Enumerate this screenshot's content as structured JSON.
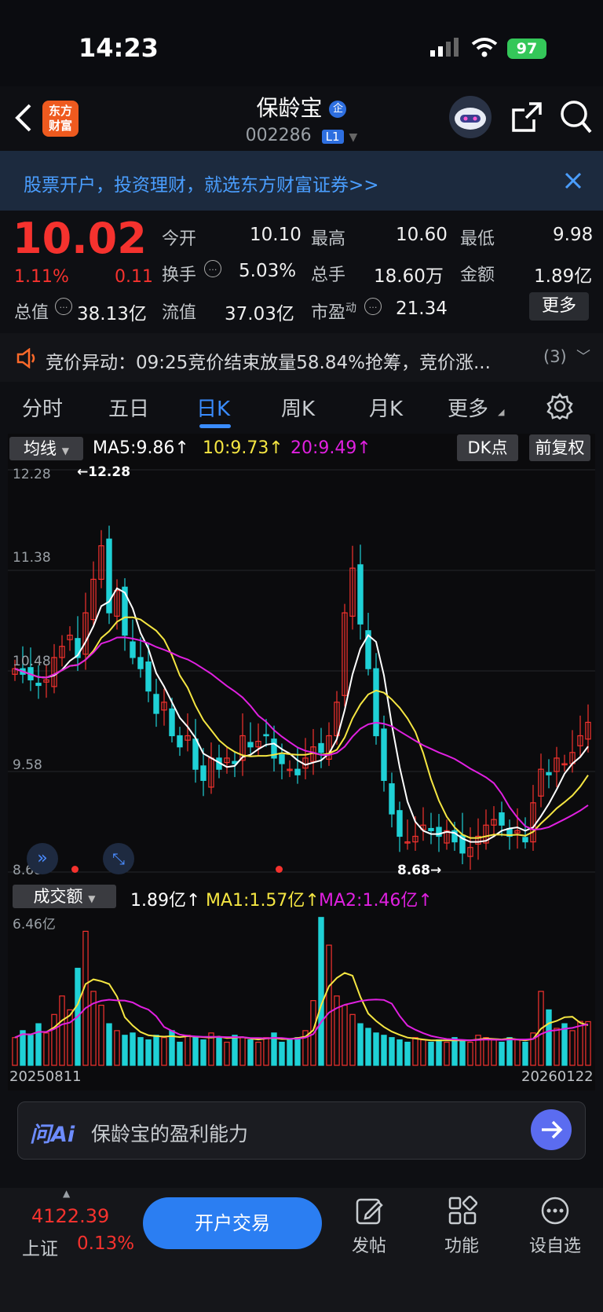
{
  "status_bar": {
    "time": "14:23",
    "battery": "97"
  },
  "header": {
    "stock_name": "保龄宝",
    "badge": "企",
    "stock_code": "002286",
    "level": "L1",
    "logo_line1": "东方",
    "logo_line2": "财富"
  },
  "banner": {
    "text": "股票开户，投资理财，就选东方财富证券>>"
  },
  "quote": {
    "price": "10.02",
    "change_pct": "1.11%",
    "change": "0.11",
    "open_label": "今开",
    "open": "10.10",
    "high_label": "最高",
    "high": "10.60",
    "low_label": "最低",
    "low": "9.98",
    "turnover_label": "换手",
    "turnover": "5.03%",
    "volume_label": "总手",
    "volume": "18.60万",
    "amount_label": "金额",
    "amount": "1.89亿",
    "mktcap_label": "总值",
    "mktcap": "38.13亿",
    "float_label": "流值",
    "float": "37.03亿",
    "pe_label": "市盈",
    "pe_sup": "动",
    "pe": "21.34",
    "more": "更多"
  },
  "auction": {
    "text": "竞价异动：09:25竞价结束放量58.84%抢筹，竞价涨...",
    "count": "(3)"
  },
  "tabs": [
    "分时",
    "五日",
    "日K",
    "周K",
    "月K",
    "更多"
  ],
  "active_tab": 2,
  "kline": {
    "selector": "均线",
    "ma5": "MA5:9.86",
    "ma10": "10:9.73",
    "ma20": "20:9.49",
    "dk": "DK点",
    "adjust": "前复权",
    "y_ticks": [
      "12.28",
      "11.38",
      "10.48",
      "9.58",
      "8.68"
    ],
    "high_marker": "12.28",
    "low_marker": "8.68"
  },
  "volume_panel": {
    "selector": "成交额",
    "value": "1.89亿",
    "ma1": "MA1:1.57亿",
    "ma2": "MA2:1.46亿",
    "y_max": "6.46亿",
    "date_start": "20250811",
    "date_end": "20260122"
  },
  "ask_ai": {
    "brand": "问Ai",
    "placeholder": "保龄宝的盈利能力"
  },
  "bottom_bar": {
    "index_value": "4122.39",
    "index_name": "上证",
    "index_change": "0.13%",
    "trade_button": "开户交易",
    "post": "发帖",
    "functions": "功能",
    "watchlist": "设自选"
  },
  "colors": {
    "up": "#f5322e",
    "down": "#1fd1d6",
    "ma5": "#ffffff",
    "ma10": "#f5e642",
    "ma20": "#e020e0",
    "accent": "#3a8cff"
  },
  "chart_data": [
    {
      "type": "candlestick",
      "title": "",
      "x_range": [
        "20250811",
        "20260122"
      ],
      "ylim": [
        8.68,
        12.28
      ],
      "y_ticks": [
        12.28,
        11.38,
        10.48,
        9.58,
        8.68
      ],
      "series": [
        {
          "name": "MA5",
          "last": 9.86
        },
        {
          "name": "MA10",
          "last": 9.73
        },
        {
          "name": "MA20",
          "last": 9.49
        }
      ],
      "close": [
        10.5,
        10.45,
        10.4,
        10.35,
        10.4,
        10.6,
        10.7,
        10.8,
        10.6,
        11.0,
        11.3,
        11.6,
        11.0,
        11.2,
        10.8,
        10.6,
        10.5,
        10.3,
        10.1,
        10.2,
        9.9,
        9.8,
        9.9,
        9.6,
        9.5,
        9.7,
        9.6,
        9.7,
        9.65,
        9.9,
        9.8,
        9.85,
        9.9,
        9.7,
        9.65,
        9.6,
        9.55,
        9.7,
        9.8,
        9.75,
        9.9,
        10.2,
        11.0,
        11.4,
        10.9,
        10.5,
        9.9,
        9.5,
        9.2,
        9.0,
        8.95,
        9.0,
        9.1,
        9.05,
        9.0,
        9.05,
        8.95,
        8.85,
        8.9,
        9.0,
        9.1,
        9.15,
        9.1,
        9.0,
        9.05,
        8.95,
        9.3,
        9.6,
        9.55,
        9.7,
        9.65,
        9.75,
        9.9,
        10.02
      ]
    },
    {
      "type": "bar",
      "title": "",
      "ylim": [
        0,
        6.46
      ],
      "series": [
        {
          "name": "MA1",
          "last": 1.57
        },
        {
          "name": "MA2",
          "last": 1.46
        }
      ],
      "values": [
        1.2,
        1.5,
        1.3,
        1.8,
        1.4,
        2.2,
        3.0,
        2.4,
        4.2,
        5.8,
        3.2,
        2.6,
        1.8,
        1.5,
        1.3,
        1.4,
        1.2,
        1.1,
        1.3,
        1.2,
        1.5,
        1.0,
        1.3,
        1.2,
        1.1,
        1.4,
        1.2,
        1.0,
        1.3,
        1.2,
        1.1,
        1.0,
        1.2,
        1.4,
        1.0,
        1.1,
        1.2,
        1.5,
        2.8,
        6.4,
        5.2,
        3.0,
        2.6,
        2.2,
        1.8,
        1.6,
        1.4,
        1.3,
        1.2,
        1.1,
        1.0,
        1.2,
        1.1,
        1.0,
        1.1,
        1.0,
        1.2,
        1.1,
        1.0,
        1.3,
        1.2,
        1.1,
        1.0,
        1.2,
        1.1,
        1.0,
        1.4,
        3.2,
        2.4,
        1.6,
        1.8,
        1.5,
        1.9,
        1.89
      ]
    }
  ]
}
